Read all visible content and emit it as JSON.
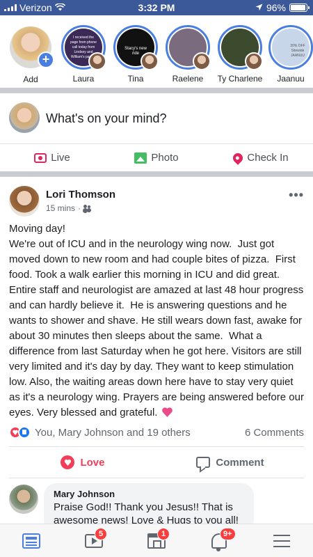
{
  "status_bar": {
    "carrier": "Verizon",
    "time": "3:32 PM",
    "battery": "96%",
    "battery_level": 0.96
  },
  "stories": [
    {
      "name": "Add",
      "type": "add",
      "plus": "+"
    },
    {
      "name": "Laura",
      "bg": "#3a2a55",
      "preview_text": "I received the page from phone call today from Lindsey and William's pastor."
    },
    {
      "name": "Tina",
      "bg": "#111111",
      "preview_text": "Stacy's new ride"
    },
    {
      "name": "Raelene",
      "bg": "#7a6c7e"
    },
    {
      "name": "Ty Charlene",
      "bg": "#3c4a2e"
    },
    {
      "name": "Jaanuu",
      "bg": "#c8d6ea",
      "preview_text": "30% OFF Sitewide JAANUU"
    }
  ],
  "composer": {
    "placeholder": "What's on your mind?"
  },
  "composer_actions": [
    {
      "label": "Live",
      "icon": "live-video-icon"
    },
    {
      "label": "Photo",
      "icon": "photo-icon"
    },
    {
      "label": "Check In",
      "icon": "location-pin-icon"
    }
  ],
  "post": {
    "author": "Lori Thomson",
    "time": "15 mins",
    "separator": "·",
    "more": "•••",
    "body": "Moving day!\nWe're out of ICU and in the neurology wing now.  Just got moved down to new room and had couple bites of pizza.  First food. Took a walk earlier this morning in ICU and did great.  Entire staff and neurologist are amazed at last 48 hour progress and can hardly believe it.  He is answering questions and he wants to shower and shave. He still wears down fast, awake for about 30 minutes then sleeps about the same.  What a difference from last Saturday when he got here. Visitors are still very limited and it's day by day. They want to keep stimulation low. Also, the waiting areas down here have to stay very quiet as it's a neurology wing. Prayers are being answered before our eyes. Very blessed and grateful.",
    "reactions_text": "You, Mary Johnson and 19 others",
    "comments_count": "6 Comments",
    "love_label": "Love",
    "comment_label": "Comment"
  },
  "comment": {
    "author": "Mary Johnson",
    "text": "Praise God!! Thank you Jesus!! That is awesome news! Love & Hugs to you all!"
  },
  "tabbar": {
    "video_badge": "5",
    "marketplace_badge": "1",
    "notifications_badge": "9+",
    "accent": "#4a7fe0",
    "badge_color": "#fa3e3e"
  }
}
